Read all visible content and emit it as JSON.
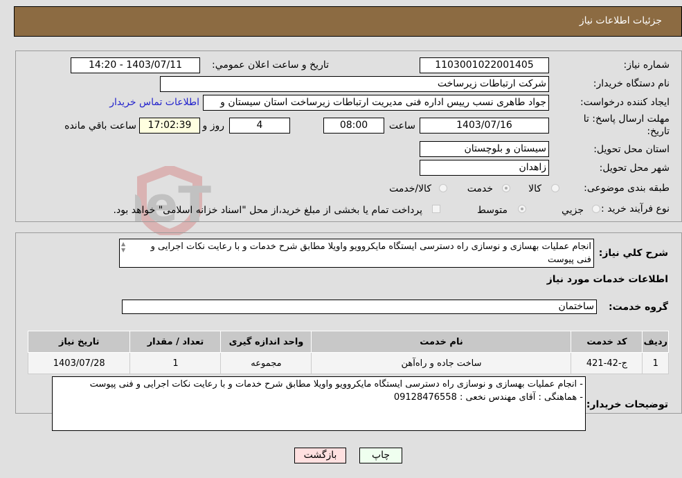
{
  "header": {
    "title": "جزئیات اطلاعات نیاز"
  },
  "form": {
    "need_number_label": "شماره نیاز:",
    "need_number": "1103001022001405",
    "announce_label": "تاريخ و ساعت اعلان عمومي:",
    "announce_value": "1403/07/11 - 14:20",
    "buyer_org_label": "نام دستگاه خریدار:",
    "buyer_org": "شرکت ارتباطات زیرساخت",
    "creator_label": "ایجاد کننده درخواست:",
    "creator": "جواد طاهری نسب رییس اداره فنی مدیریت ارتباطات زیرساخت استان سیستان و",
    "contact_link": "اطلاعات تماس خریدار",
    "deadline_label": "مهلت ارسال پاسخ: تا تاریخ:",
    "deadline_date": "1403/07/16",
    "time_label": "ساعت",
    "deadline_time": "08:00",
    "days_value": "4",
    "days_label": "روز و",
    "remaining_time": "17:02:39",
    "remaining_label": "ساعت باقي مانده",
    "province_label": "استان محل تحویل:",
    "province": "سیستان و بلوچستان",
    "city_label": "شهر محل تحویل:",
    "city": "زاهدان",
    "category_label": "طبقه بندی موضوعی:",
    "category_options": [
      "کالا",
      "خدمت",
      "کالا/خدمت"
    ],
    "category_selected": "خدمت",
    "process_label": "نوع فرآیند خرید :",
    "process_options": [
      "جزيي",
      "متوسط"
    ],
    "process_selected": "متوسط",
    "treasury_note": "پرداخت تمام یا بخشی از مبلغ خرید،از محل \"اسناد خزانه اسلامی\" خواهد بود."
  },
  "details": {
    "summary_label": "شرح کلي نياز:",
    "summary": "انجام عملیات بهسازی و نوسازی راه دسترسی ایستگاه مایکروویو واویلا مطابق شرح خدمات و با رعایت نکات اجرایی و فنی پیوست",
    "services_heading": "اطلاعات خدمات مورد نیاز",
    "group_label": "گروه خدمت:",
    "group_value": "ساختمان",
    "table": {
      "headers": [
        "ردیف",
        "کد خدمت",
        "نام خدمت",
        "واحد اندازه گیری",
        "تعداد / مقدار",
        "تاریخ نیاز"
      ],
      "rows": [
        [
          "1",
          "ج-42-421",
          "ساخت جاده و راه‌آهن",
          "مجموعه",
          "1",
          "1403/07/28"
        ]
      ]
    },
    "buyer_notes_label": "توضیحات خریدار:",
    "buyer_notes_line1": "- انجام عملیات بهسازی و نوسازی راه دسترسی ایستگاه مایکروویو واویلا مطابق شرح خدمات و با رعایت نکات اجرایی و فنی پیوست",
    "buyer_notes_line2": "- هماهنگی : آقای مهندس نخعی : 09128476558"
  },
  "buttons": {
    "print": "چاپ",
    "back": "بازگشت"
  },
  "watermark": "AriaTender.neT"
}
